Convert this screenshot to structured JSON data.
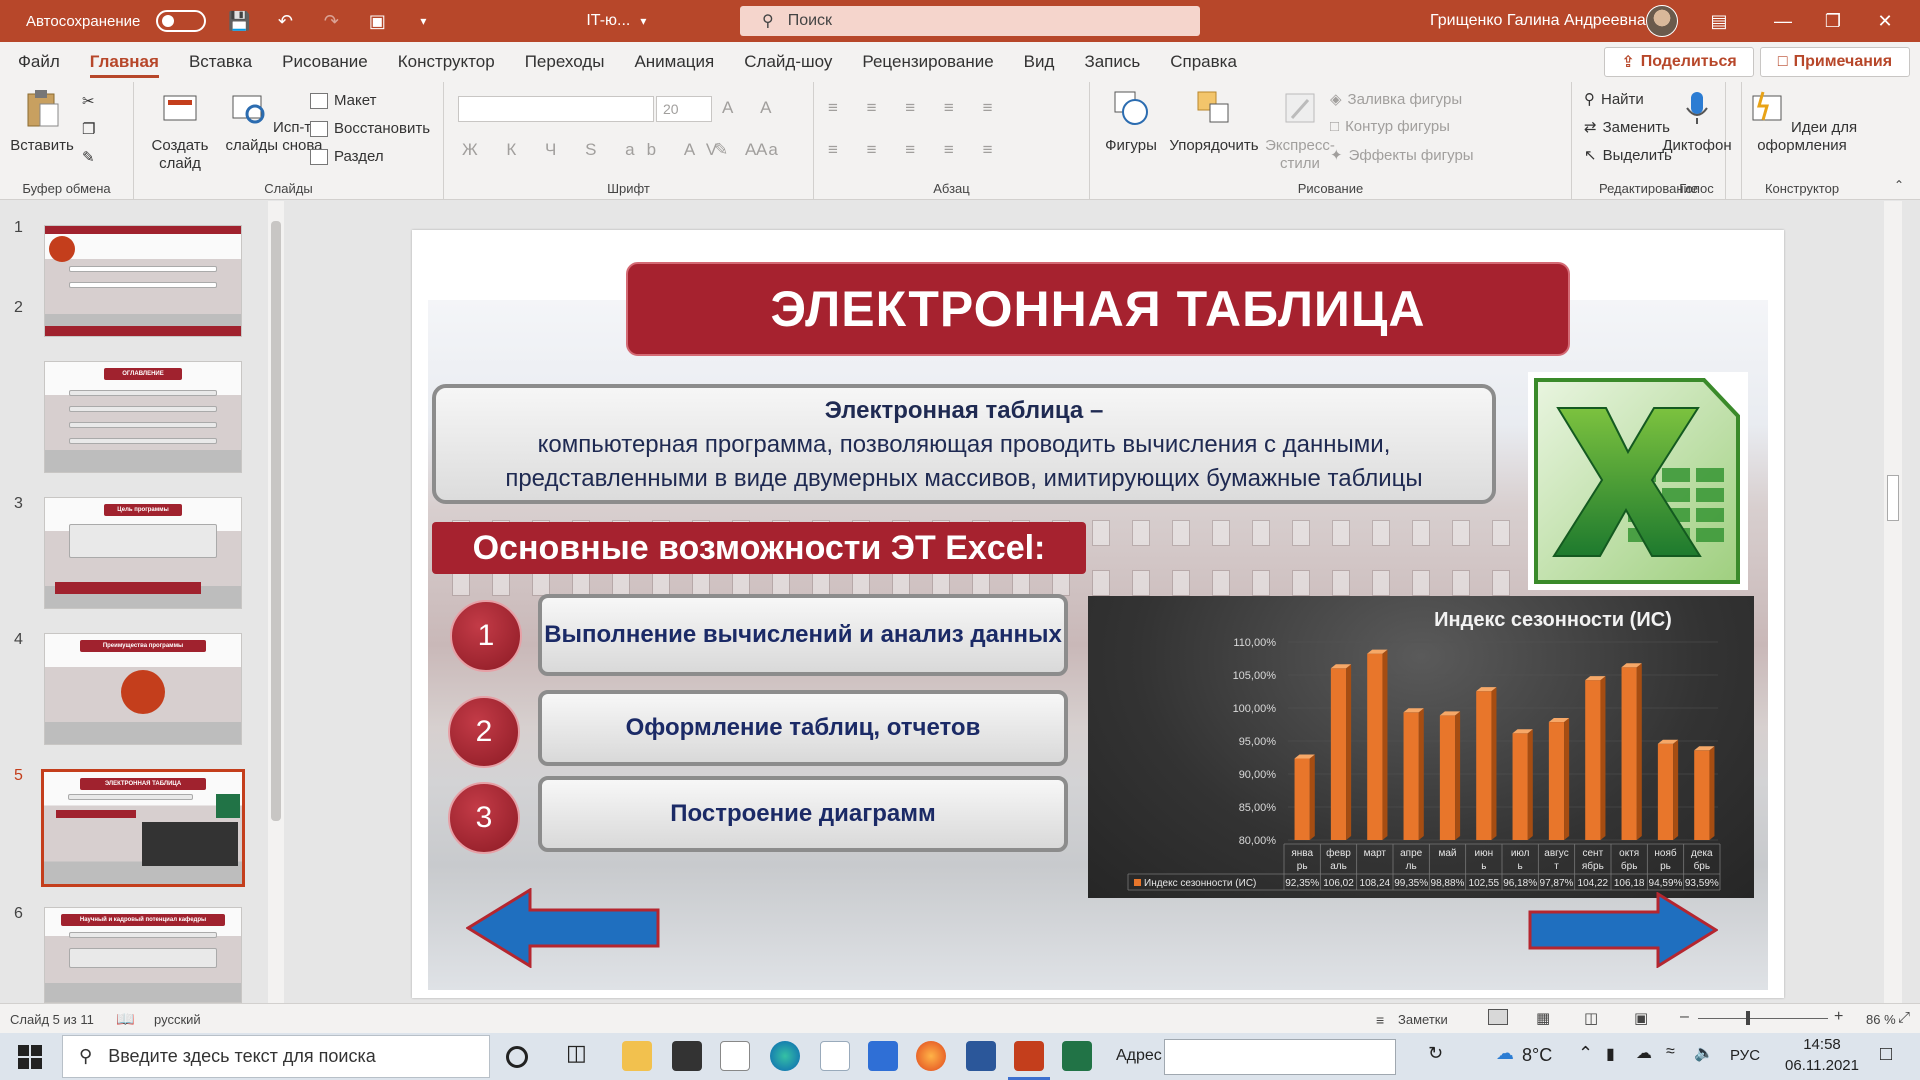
{
  "titlebar": {
    "autosave_label": "Автосохранение",
    "doc_name": "IT-ю...",
    "search_placeholder": "Поиск",
    "user_name": "Грищенко Галина Андреевна"
  },
  "tabs": [
    "Файл",
    "Главная",
    "Вставка",
    "Рисование",
    "Конструктор",
    "Переходы",
    "Анимация",
    "Слайд-шоу",
    "Рецензирование",
    "Вид",
    "Запись",
    "Справка"
  ],
  "share_label": "Поделиться",
  "notes_label": "Примечания",
  "ribbon": {
    "paste": "Вставить",
    "clipboard_group": "Буфер обмена",
    "new_slide": "Создать слайд",
    "reuse": "Исп-ть слайды снова",
    "layout": "Макет",
    "reset": "Восстановить",
    "section": "Раздел",
    "slides_group": "Слайды",
    "font_size": "20",
    "font_group": "Шрифт",
    "paragraph_group": "Абзац",
    "shapes": "Фигуры",
    "arrange": "Упорядочить",
    "quick_styles": "Экспресс-стили",
    "shape_fill": "Заливка фигуры",
    "shape_outline": "Контур фигуры",
    "shape_effects": "Эффекты фигуры",
    "drawing_group": "Рисование",
    "find": "Найти",
    "replace": "Заменить",
    "select": "Выделить",
    "editing_group": "Редактирование",
    "dictate": "Диктофон",
    "voice_group": "Голос",
    "design_ideas": "Идеи для оформления",
    "designer_group": "Конструктор"
  },
  "thumbnails": [
    {
      "num": "1",
      "title": ""
    },
    {
      "num": "2",
      "title": "ОГЛАВЛЕНИЕ"
    },
    {
      "num": "3",
      "title": "Цель программы"
    },
    {
      "num": "4",
      "title": "Преимущества программы"
    },
    {
      "num": "5",
      "title": "ЭЛЕКТРОННАЯ ТАБЛИЦА"
    },
    {
      "num": "6",
      "title": "Научный и кадровый потенциал кафедры"
    }
  ],
  "slide": {
    "title": "ЭЛЕКТРОННАЯ ТАБЛИЦА",
    "def_bold": "Электронная таблица –",
    "def_line1": "компьютерная программа, позволяющая проводить вычисления с данными,",
    "def_line2": "представленными в виде двумерных массивов, имитирующих бумажные таблицы",
    "features_title": "Основные возможности ЭТ Excel:",
    "features": [
      {
        "num": "1",
        "text": "Выполнение вычислений и анализ данных"
      },
      {
        "num": "2",
        "text": "Оформление таблиц, отчетов"
      },
      {
        "num": "3",
        "text": "Построение диаграмм"
      }
    ]
  },
  "chart_data": {
    "type": "bar",
    "title": "Индекс сезонности (ИС)",
    "categories": [
      "январь",
      "февраль",
      "март",
      "апрель",
      "май",
      "июнь",
      "июль",
      "август",
      "сентябрь",
      "октябрь",
      "ноябрь",
      "декабрь"
    ],
    "category_labels": [
      [
        "янва",
        "рь"
      ],
      [
        "февр",
        "аль"
      ],
      [
        "март",
        ""
      ],
      [
        "апре",
        "ль"
      ],
      [
        "май",
        ""
      ],
      [
        "июн",
        "ь"
      ],
      [
        "июл",
        "ь"
      ],
      [
        "авгус",
        "т"
      ],
      [
        "сент",
        "ябрь"
      ],
      [
        "октя",
        "брь"
      ],
      [
        "нояб",
        "рь"
      ],
      [
        "дека",
        "брь"
      ]
    ],
    "series": [
      {
        "name": "Индекс сезонности (ИС)",
        "values": [
          92.35,
          106.02,
          108.24,
          99.35,
          98.88,
          102.55,
          96.18,
          97.87,
          104.22,
          106.18,
          94.59,
          93.59
        ]
      }
    ],
    "table_values": [
      "92,35%",
      "106,02",
      "108,24",
      "99,35%",
      "98,88%",
      "102,55",
      "96,18%",
      "97,87%",
      "104,22",
      "106,18",
      "94,59%",
      "93,59%"
    ],
    "yticks": [
      "110,00%",
      "105,00%",
      "100,00%",
      "95,00%",
      "90,00%",
      "85,00%",
      "80,00%"
    ],
    "ylim": [
      80,
      110
    ],
    "legend_position": "data-table",
    "bar_color": "#e8762b"
  },
  "statusbar": {
    "slide_info": "Слайд 5 из 11",
    "language": "русский",
    "notes": "Заметки",
    "zoom": "86 %"
  },
  "taskbar": {
    "search_placeholder": "Введите здесь текст для поиска",
    "address_label": "Адрес",
    "temperature": "8°C",
    "lang": "РУС",
    "time": "14:58",
    "date": "06.11.2021"
  }
}
